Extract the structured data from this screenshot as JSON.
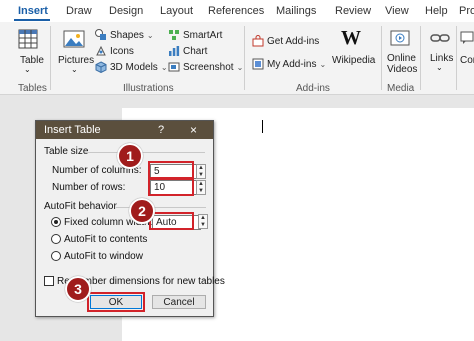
{
  "tabs": [
    "Insert",
    "Draw",
    "Design",
    "Layout",
    "References",
    "Mailings",
    "Review",
    "View",
    "Help",
    "Propert"
  ],
  "ribbon": {
    "table_label": "Table",
    "pictures_label": "Pictures",
    "shapes_label": "Shapes",
    "icons_label": "Icons",
    "models_label": "3D Models",
    "smartart_label": "SmartArt",
    "chart_label": "Chart",
    "screenshot_label": "Screenshot",
    "get_addins_label": "Get Add-ins",
    "my_addins_label": "My Add-ins",
    "wikipedia_label": "Wikipedia",
    "online_videos_label": "Online Videos",
    "links_label": "Links",
    "comment_label": "Com",
    "groups": {
      "tables": "Tables",
      "illustrations": "Illustrations",
      "addins": "Add-ins",
      "media": "Media"
    }
  },
  "dialog": {
    "title": "Insert Table",
    "help": "?",
    "close": "×",
    "table_size_heading": "Table size",
    "columns_label": "Number of columns:",
    "columns_value": "5",
    "rows_label": "Number of rows:",
    "rows_value": "10",
    "autofit_heading": "AutoFit behavior",
    "fixed_label": "Fixed column width:",
    "fixed_value": "Auto",
    "autofit_contents_label": "AutoFit to contents",
    "autofit_window_label": "AutoFit to window",
    "remember_label": "Remember dimensions for new tables",
    "ok_label": "OK",
    "cancel_label": "Cancel"
  },
  "badges": [
    "1",
    "2",
    "3"
  ],
  "colors": {
    "accent": "#1a5fa8",
    "title_bar": "#5b4f3d",
    "highlight": "#d2232a",
    "badge": "#a01c1c"
  }
}
